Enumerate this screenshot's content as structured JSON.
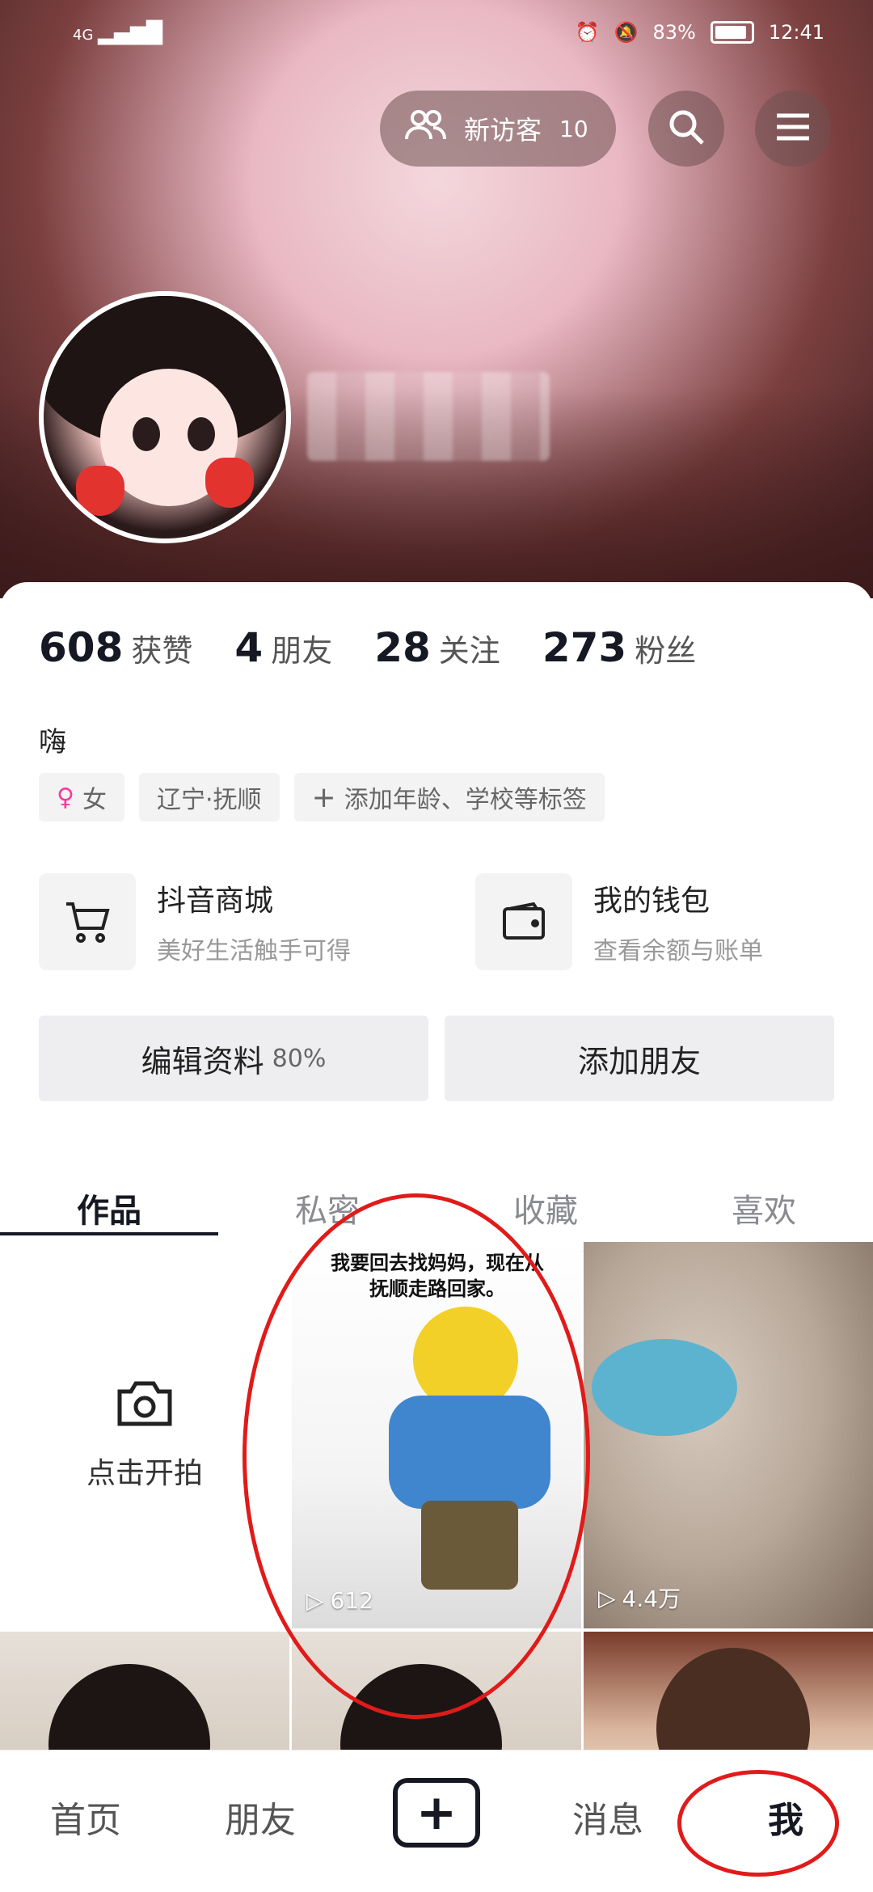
{
  "status_bar": {
    "network": "4G",
    "battery": "83%",
    "time": "12:41"
  },
  "header": {
    "visitor_label": "新访客",
    "visitor_count": "10"
  },
  "stats": [
    {
      "num": "608",
      "label": "获赞"
    },
    {
      "num": "4",
      "label": "朋友"
    },
    {
      "num": "28",
      "label": "关注"
    },
    {
      "num": "273",
      "label": "粉丝"
    }
  ],
  "profile": {
    "bio": "嗨",
    "tags": [
      "女",
      "辽宁·抚顺",
      "添加年龄、学校等标签"
    ]
  },
  "services": [
    {
      "title": "抖音商城",
      "subtitle": "美好生活触手可得",
      "icon": "cart-icon"
    },
    {
      "title": "我的钱包",
      "subtitle": "查看余额与账单",
      "icon": "wallet-icon"
    }
  ],
  "buttons": {
    "edit_profile": "编辑资料",
    "edit_percent": "80%",
    "add_friend": "添加朋友"
  },
  "tabs": [
    "作品",
    "私密",
    "收藏",
    "喜欢"
  ],
  "grid": {
    "camera_label": "点击开拍",
    "video2_caption": "我要回去找妈妈，现在从抚顺走路回家。",
    "video2_plays": "612",
    "video3_plays": "4.4万"
  },
  "bottom_nav": [
    "首页",
    "朋友",
    "消息",
    "我"
  ],
  "colors": {
    "accent_red": "#e11a1a",
    "text_dark": "#161823"
  }
}
